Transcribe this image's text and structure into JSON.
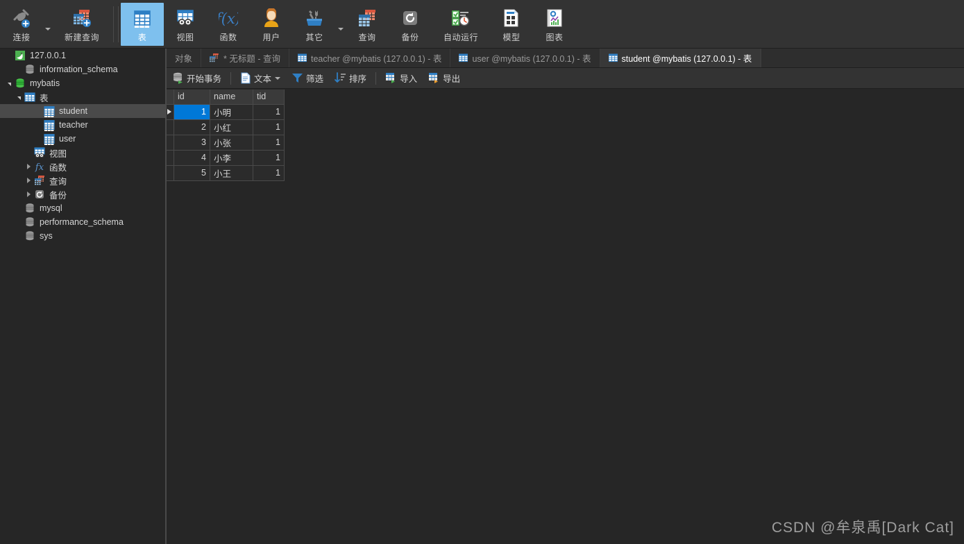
{
  "ribbon": {
    "items": [
      {
        "label": "连接",
        "icon": "connection-icon",
        "caret": true,
        "active": false,
        "wide": false
      },
      {
        "label": "新建查询",
        "icon": "new-query-icon",
        "caret": false,
        "active": false,
        "wide": true
      },
      {
        "label": "表",
        "icon": "table-icon",
        "caret": false,
        "active": true,
        "wide": false
      },
      {
        "label": "视图",
        "icon": "view-icon",
        "caret": false,
        "active": false,
        "wide": false
      },
      {
        "label": "函数",
        "icon": "function-icon",
        "caret": false,
        "active": false,
        "wide": false
      },
      {
        "label": "用户",
        "icon": "user-icon",
        "caret": false,
        "active": false,
        "wide": false
      },
      {
        "label": "其它",
        "icon": "other-tools-icon",
        "caret": true,
        "active": false,
        "wide": false
      },
      {
        "label": "查询",
        "icon": "query-icon",
        "caret": false,
        "active": false,
        "wide": false
      },
      {
        "label": "备份",
        "icon": "backup-icon",
        "caret": false,
        "active": false,
        "wide": false
      },
      {
        "label": "自动运行",
        "icon": "automation-icon",
        "caret": false,
        "active": false,
        "wide": true
      },
      {
        "label": "模型",
        "icon": "model-icon",
        "caret": false,
        "active": false,
        "wide": false
      },
      {
        "label": "图表",
        "icon": "chart-icon",
        "caret": false,
        "active": false,
        "wide": false
      }
    ],
    "accent_active": "#7EC0EE"
  },
  "sidebar": {
    "items": [
      {
        "label": "127.0.0.1",
        "icon": "mysql-connection-icon",
        "indent": 0,
        "arrow": "none",
        "selected": false
      },
      {
        "label": "information_schema",
        "icon": "database-closed-icon",
        "indent": 1,
        "arrow": "none",
        "selected": false
      },
      {
        "label": "mybatis",
        "icon": "database-open-icon",
        "indent": 0,
        "arrow": "open",
        "selected": false
      },
      {
        "label": "表",
        "icon": "table-folder-icon",
        "indent": 1,
        "arrow": "open",
        "selected": false
      },
      {
        "label": "student",
        "icon": "table-icon",
        "indent": 3,
        "arrow": "none",
        "selected": true
      },
      {
        "label": "teacher",
        "icon": "table-icon",
        "indent": 3,
        "arrow": "none",
        "selected": false
      },
      {
        "label": "user",
        "icon": "table-icon",
        "indent": 3,
        "arrow": "none",
        "selected": false
      },
      {
        "label": "视图",
        "icon": "view-folder-icon",
        "indent": 2,
        "arrow": "none",
        "selected": false
      },
      {
        "label": "函数",
        "icon": "function-folder-icon",
        "indent": 2,
        "arrow": "closed",
        "selected": false
      },
      {
        "label": "查询",
        "icon": "query-folder-icon",
        "indent": 2,
        "arrow": "closed",
        "selected": false
      },
      {
        "label": "备份",
        "icon": "backup-folder-icon",
        "indent": 2,
        "arrow": "closed",
        "selected": false
      },
      {
        "label": "mysql",
        "icon": "database-closed-icon",
        "indent": 1,
        "arrow": "none",
        "selected": false
      },
      {
        "label": "performance_schema",
        "icon": "database-closed-icon",
        "indent": 1,
        "arrow": "none",
        "selected": false
      },
      {
        "label": "sys",
        "icon": "database-closed-icon",
        "indent": 1,
        "arrow": "none",
        "selected": false
      }
    ]
  },
  "tabs": [
    {
      "label": "对象",
      "icon": "none",
      "active": false
    },
    {
      "label": "* 无标题 - 查询",
      "icon": "query-icon",
      "active": false
    },
    {
      "label": "teacher @mybatis (127.0.0.1) - 表",
      "icon": "table-icon",
      "active": false
    },
    {
      "label": "user @mybatis (127.0.0.1) - 表",
      "icon": "table-icon",
      "active": false
    },
    {
      "label": "student @mybatis (127.0.0.1) - 表",
      "icon": "table-icon",
      "active": true
    }
  ],
  "gridbar": {
    "items": [
      {
        "label": "开始事务",
        "icon": "transaction-icon",
        "caret": false,
        "sep_after": true
      },
      {
        "label": "文本",
        "icon": "text-icon",
        "caret": true,
        "sep_after": false
      },
      {
        "label": "筛选",
        "icon": "filter-icon",
        "caret": false,
        "sep_after": false
      },
      {
        "label": "排序",
        "icon": "sort-icon",
        "caret": false,
        "sep_after": true
      },
      {
        "label": "导入",
        "icon": "import-icon",
        "caret": false,
        "sep_after": false
      },
      {
        "label": "导出",
        "icon": "export-icon",
        "caret": false,
        "sep_after": false
      }
    ]
  },
  "grid": {
    "columns": [
      "id",
      "name",
      "tid"
    ],
    "rows": [
      {
        "id": "1",
        "name": "小明",
        "tid": "1",
        "current": true
      },
      {
        "id": "2",
        "name": "小红",
        "tid": "1",
        "current": false
      },
      {
        "id": "3",
        "name": "小张",
        "tid": "1",
        "current": false
      },
      {
        "id": "4",
        "name": "小李",
        "tid": "1",
        "current": false
      },
      {
        "id": "5",
        "name": "小王",
        "tid": "1",
        "current": false
      }
    ],
    "selected_cell": {
      "row": 0,
      "column": "id"
    },
    "selection_color": "#0078D7"
  },
  "watermark": {
    "text": "CSDN @牟泉禹[Dark Cat]"
  }
}
